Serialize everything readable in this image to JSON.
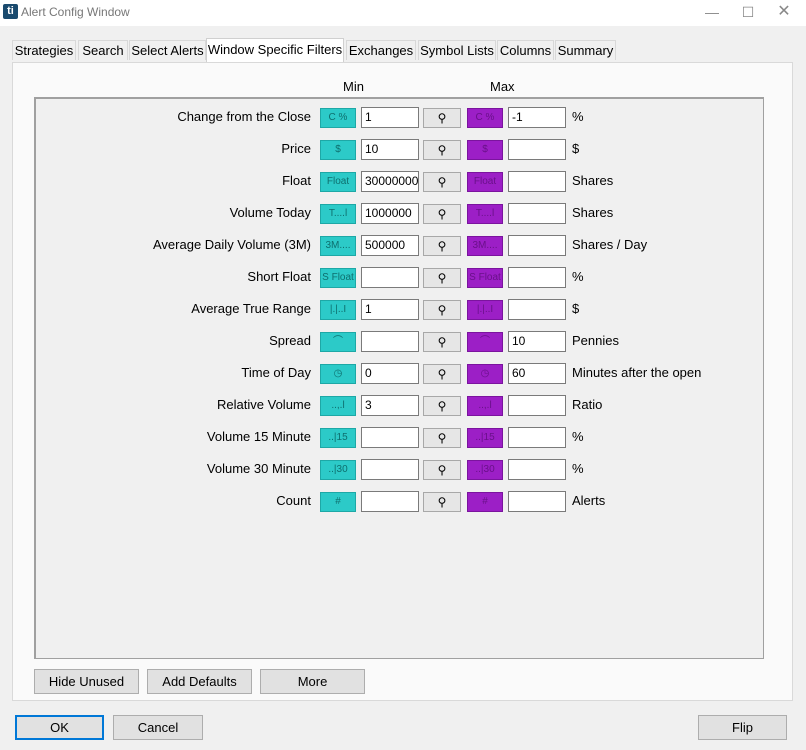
{
  "window": {
    "title": "Alert Config Window",
    "app_icon_text": "ti",
    "minimize": "—",
    "maximize": "☐",
    "close": "✕"
  },
  "tabs": [
    {
      "label": "Strategies"
    },
    {
      "label": "Search"
    },
    {
      "label": "Select Alerts"
    },
    {
      "label": "Window Specific Filters",
      "active": true
    },
    {
      "label": "Exchanges"
    },
    {
      "label": "Symbol Lists"
    },
    {
      "label": "Columns"
    },
    {
      "label": "Summary"
    }
  ],
  "headers": {
    "min": "Min",
    "max": "Max"
  },
  "search_glyph": "⚲",
  "colors": {
    "min_icon": "#2ccac8",
    "max_icon": "#9c1fc6"
  },
  "filters": [
    {
      "label": "Change from the Close",
      "icon": "C %",
      "min": "1",
      "max": "-1",
      "unit": "%"
    },
    {
      "label": "Price",
      "icon": "$",
      "min": "10",
      "max": "",
      "unit": "$"
    },
    {
      "label": "Float",
      "icon": "Float",
      "min": "30000000",
      "max": "",
      "unit": "Shares"
    },
    {
      "label": "Volume Today",
      "icon": "T....l",
      "min": "1000000",
      "max": "",
      "unit": "Shares"
    },
    {
      "label": "Average Daily Volume (3M)",
      "icon": "3M....",
      "min": "500000",
      "max": "",
      "unit": "Shares / Day"
    },
    {
      "label": "Short Float",
      "icon": "S Float",
      "min": "",
      "max": "",
      "unit": "%"
    },
    {
      "label": "Average True Range",
      "icon": "|.|..I",
      "min": "1",
      "max": "",
      "unit": "$"
    },
    {
      "label": "Spread",
      "icon": "⌒",
      "min": "",
      "max": "10",
      "unit": "Pennies"
    },
    {
      "label": "Time of Day",
      "icon": "◷",
      "min": "0",
      "max": "60",
      "unit": "Minutes after the open"
    },
    {
      "label": "Relative Volume",
      "icon": "..,.l",
      "min": "3",
      "max": "",
      "unit": "Ratio"
    },
    {
      "label": "Volume 15 Minute",
      "icon": "..|15",
      "min": "",
      "max": "",
      "unit": "%"
    },
    {
      "label": "Volume 30 Minute",
      "icon": "..|30",
      "min": "",
      "max": "",
      "unit": "%"
    },
    {
      "label": "Count",
      "icon": "#",
      "min": "",
      "max": "",
      "unit": "Alerts"
    }
  ],
  "panel_buttons": {
    "hide_unused": "Hide Unused",
    "add_defaults": "Add Defaults",
    "more": "More"
  },
  "footer_buttons": {
    "ok": "OK",
    "cancel": "Cancel",
    "flip": "Flip"
  }
}
